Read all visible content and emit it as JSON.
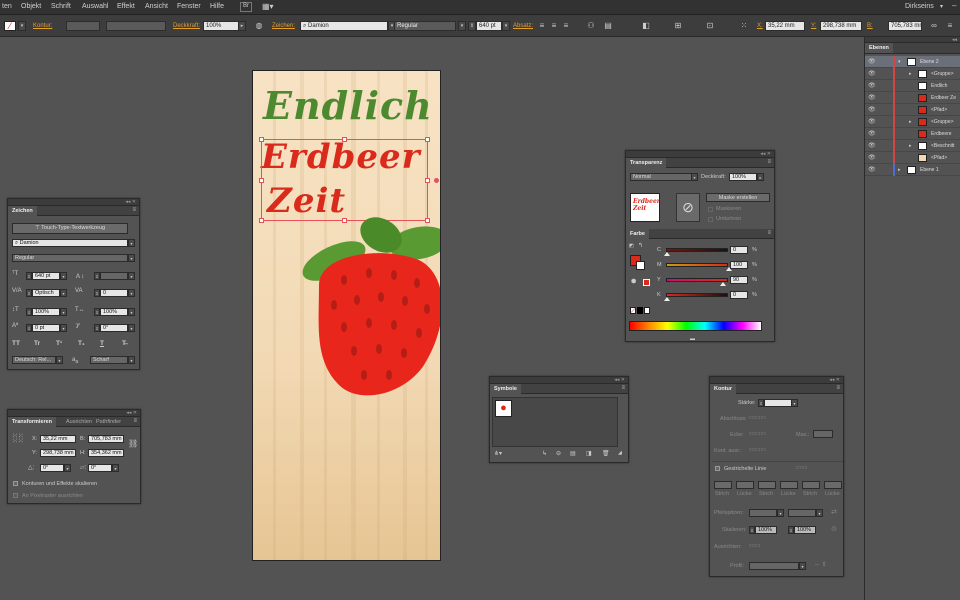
{
  "menu": [
    "ten",
    "Objekt",
    "Schrift",
    "Auswahl",
    "Effekt",
    "Ansicht",
    "Fenster",
    "Hilfe"
  ],
  "workspace": "Dirkseins",
  "control": {
    "kontur_label": "Kontur:",
    "deckkraft_label": "Deckkraft:",
    "deckkraft_value": "100%",
    "zeichen_label": "Zeichen:",
    "font_name": "Damion",
    "font_style": "Regular",
    "font_size": "640 pt",
    "absatz_label": "Absatz:",
    "x_label": "X:",
    "x_value": "35,22 mm",
    "y_label": "Y:",
    "y_value": "298,738 mm",
    "b_label": "B:",
    "b_value": "705,783 mm"
  },
  "artboard": {
    "line1": "Endlich",
    "line2": "Erdbeer",
    "line3": "Zeit"
  },
  "zeichen": {
    "tab": "Zeichen",
    "touch_button": "Touch-Type-Textwerkzeug",
    "font": "Damion",
    "style": "Regular",
    "size": "640 pt",
    "kerning": "Optisch",
    "tracking": "0",
    "hscale": "100%",
    "vscale": "100%",
    "baseline": "0 pt",
    "rotation": "0°",
    "language": "Deutsch: Rel...",
    "aa_label": "a",
    "aa": "Scharf",
    "tt_buttons": [
      "TT",
      "Tr",
      "T¹",
      "T₁",
      "T",
      "T̶"
    ]
  },
  "transform": {
    "tabs": [
      "Transformieren",
      "Ausrichten",
      "Pathfinder"
    ],
    "x_label": "X:",
    "x": "35,22 mm",
    "b_label": "B:",
    "b": "705,783 mm",
    "y_label": "Y:",
    "y": "298,738 mm",
    "h_label": "H:",
    "h": "354,362 mm",
    "angle1": "0°",
    "angle2": "0°",
    "check1": "Konturen und Effekte skalieren",
    "check2": "An Pixelraster ausrichten"
  },
  "transparency": {
    "tab": "Transparenz",
    "mode": "Normal",
    "opacity_label": "Deckkraft:",
    "opacity": "100%",
    "mask_button": "Maske erstellen",
    "clip": "Maskieren",
    "invert": "Umkehren",
    "thumb_line1": "Erdbeer",
    "thumb_line2": "Zeit"
  },
  "color": {
    "tab": "Farbe",
    "channels": [
      {
        "label": "C",
        "value": "0",
        "frac": 0.0,
        "color": "#00a0d0"
      },
      {
        "label": "M",
        "value": "100",
        "frac": 1.0,
        "color": "#e0007a"
      },
      {
        "label": "Y",
        "value": "90",
        "frac": 0.9,
        "color": "#f0e000"
      },
      {
        "label": "K",
        "value": "0",
        "frac": 0.0,
        "color": "#202020"
      }
    ],
    "percent": "%",
    "fill": "#d92a1c"
  },
  "symbole": {
    "tab": "Symbole"
  },
  "kontur": {
    "tab": "Kontur",
    "staerke": "Stärke:",
    "abschluss": "Abschluss:",
    "ecke": "Ecke:",
    "max": "Max.:",
    "kontur_ausr": "Kont. ausr.:",
    "dashed": "Gestrichelte Linie",
    "strich": "Strich",
    "luecke": "Lücke",
    "pfeilspitzen": "Pfeilspitzen:",
    "skalieren": "Skalieren:",
    "scale1": "100%",
    "scale2": "100%",
    "ausrichten": "Ausrichten:",
    "profil": "Profil:"
  },
  "layers": {
    "tab": "Ebenen",
    "rows": [
      {
        "name": "Ebene 2",
        "indent": 0,
        "top": true
      },
      {
        "name": "<Gruppe>",
        "indent": 1
      },
      {
        "name": "Endlich",
        "indent": 1
      },
      {
        "name": "Erdbeer Ze",
        "indent": 1
      },
      {
        "name": "<Pfad>",
        "indent": 1
      },
      {
        "name": "<Gruppe>",
        "indent": 1
      },
      {
        "name": "Erdbeere",
        "indent": 1
      },
      {
        "name": "<Beschnitt",
        "indent": 1
      },
      {
        "name": "<Pfad>",
        "indent": 1
      },
      {
        "name": "Ebene 1",
        "indent": 0,
        "top": true
      }
    ]
  },
  "colors": {
    "green": "#4d8a2f",
    "red": "#d92a1c",
    "accent": "#e39e2c"
  }
}
